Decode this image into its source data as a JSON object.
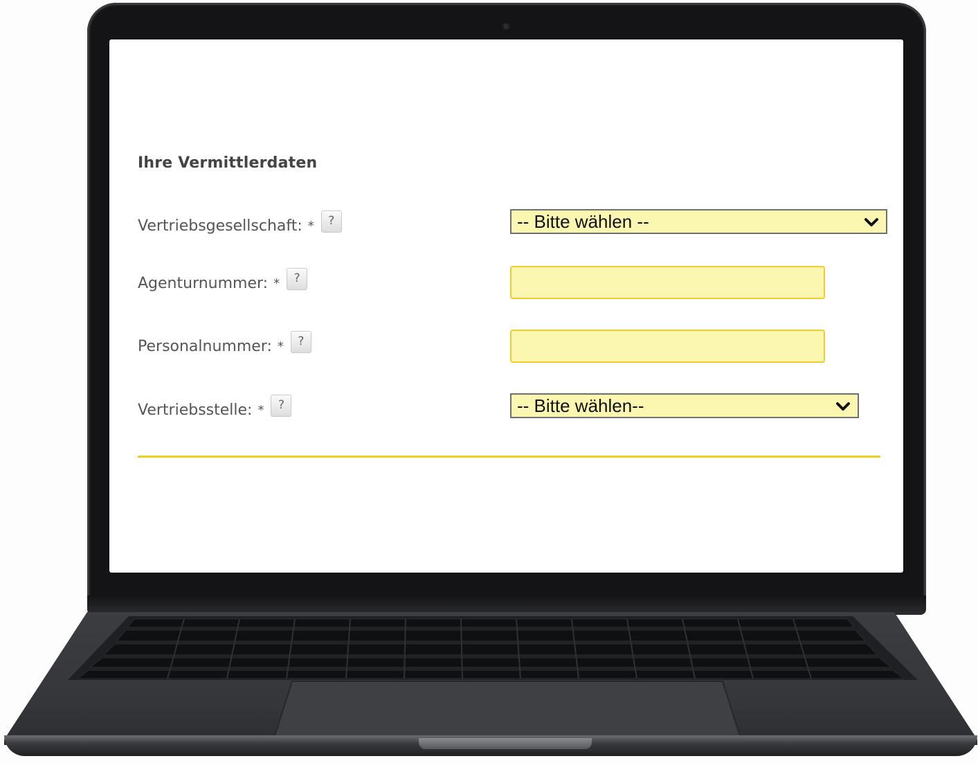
{
  "form": {
    "title": "Ihre Vermittlerdaten",
    "fields": [
      {
        "label": "Vertriebsgesellschaft:",
        "required_mark": "*",
        "help": "?",
        "type": "select",
        "value": "-- Bitte wählen --"
      },
      {
        "label": "Agenturnummer:",
        "required_mark": "*",
        "help": "?",
        "type": "text",
        "value": ""
      },
      {
        "label": "Personalnummer:",
        "required_mark": "*",
        "help": "?",
        "type": "text",
        "value": ""
      },
      {
        "label": "Vertriebsstelle:",
        "required_mark": "*",
        "help": "?",
        "type": "select",
        "value": "-- Bitte wählen--"
      }
    ]
  },
  "colors": {
    "field_background": "#fbf6b0",
    "field_border_accent": "#f2cc2c",
    "divider": "#f4cd1d"
  },
  "icons": {
    "help": "question-mark-icon",
    "dropdown": "chevron-down-icon"
  }
}
